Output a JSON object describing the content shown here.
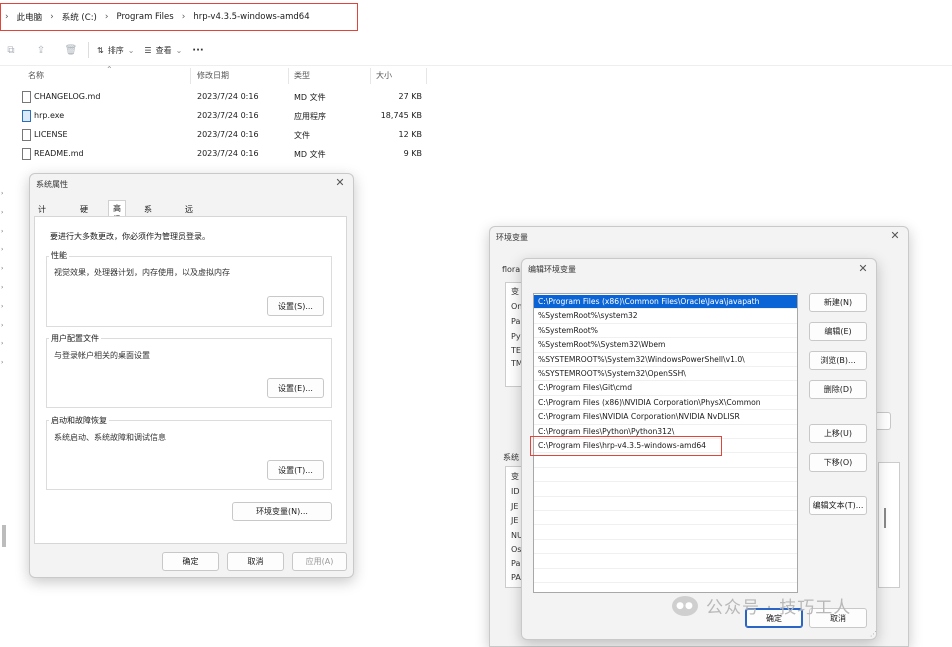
{
  "explorer": {
    "breadcrumb": [
      "此电脑",
      "系统 (C:)",
      "Program Files",
      "hrp-v4.3.5-windows-amd64"
    ],
    "toolbar": {
      "sort_label": "排序",
      "view_label": "查看",
      "more_label": "···"
    },
    "columns": {
      "name": "名称",
      "modified": "修改日期",
      "type": "类型",
      "size": "大小"
    },
    "files": [
      {
        "name": "CHANGELOG.md",
        "modified": "2023/7/24 0:16",
        "type": "MD 文件",
        "size": "27 KB"
      },
      {
        "name": "hrp.exe",
        "modified": "2023/7/24 0:16",
        "type": "应用程序",
        "size": "18,745 KB"
      },
      {
        "name": "LICENSE",
        "modified": "2023/7/24 0:16",
        "type": "文件",
        "size": "12 KB"
      },
      {
        "name": "README.md",
        "modified": "2023/7/24 0:16",
        "type": "MD 文件",
        "size": "9 KB"
      }
    ]
  },
  "sysprops": {
    "title": "系统属性",
    "tabs": [
      "计算机名",
      "硬件",
      "高级",
      "系统保护",
      "远程"
    ],
    "active_tab": "高级",
    "notice": "要进行大多数更改，你必须作为管理员登录。",
    "groups": [
      {
        "label": "性能",
        "desc": "视觉效果，处理器计划，内存使用，以及虚拟内存",
        "button": "设置(S)..."
      },
      {
        "label": "用户配置文件",
        "desc": "与登录帐户相关的桌面设置",
        "button": "设置(E)..."
      },
      {
        "label": "启动和故障恢复",
        "desc": "系统启动、系统故障和调试信息",
        "button": "设置(T)..."
      }
    ],
    "env_button": "环境变量(N)...",
    "ok": "确定",
    "cancel": "取消",
    "apply": "应用(A)"
  },
  "envvars": {
    "title": "环境变量",
    "user_section_prefix": "flora",
    "user_col_letters": [
      "变",
      "On",
      "Pa",
      "Py",
      "TE",
      "TM"
    ],
    "system_section_prefix": "系统",
    "system_col_letters": [
      "变",
      "ID",
      "JE",
      "JE",
      "NU",
      "Os",
      "Pa",
      "PA"
    ]
  },
  "editenv": {
    "title": "编辑环境变量",
    "paths": [
      "C:\\Program Files (x86)\\Common Files\\Oracle\\Java\\javapath",
      "%SystemRoot%\\system32",
      "%SystemRoot%",
      "%SystemRoot%\\System32\\Wbem",
      "%SYSTEMROOT%\\System32\\WindowsPowerShell\\v1.0\\",
      "%SYSTEMROOT%\\System32\\OpenSSH\\",
      "C:\\Program Files\\Git\\cmd",
      "C:\\Program Files (x86)\\NVIDIA Corporation\\PhysX\\Common",
      "C:\\Program Files\\NVIDIA Corporation\\NVIDIA NvDLISR",
      "C:\\Program Files\\Python\\Python312\\",
      "C:\\Program Files\\hrp-v4.3.5-windows-amd64"
    ],
    "buttons": {
      "new": "新建(N)",
      "edit": "编辑(E)",
      "browse": "浏览(B)...",
      "delete": "删除(D)",
      "up": "上移(U)",
      "down": "下移(O)",
      "edit_text": "编辑文本(T)..."
    },
    "ok": "确定",
    "cancel": "取消"
  },
  "watermark": {
    "text": "公众号 · 技巧工人"
  }
}
